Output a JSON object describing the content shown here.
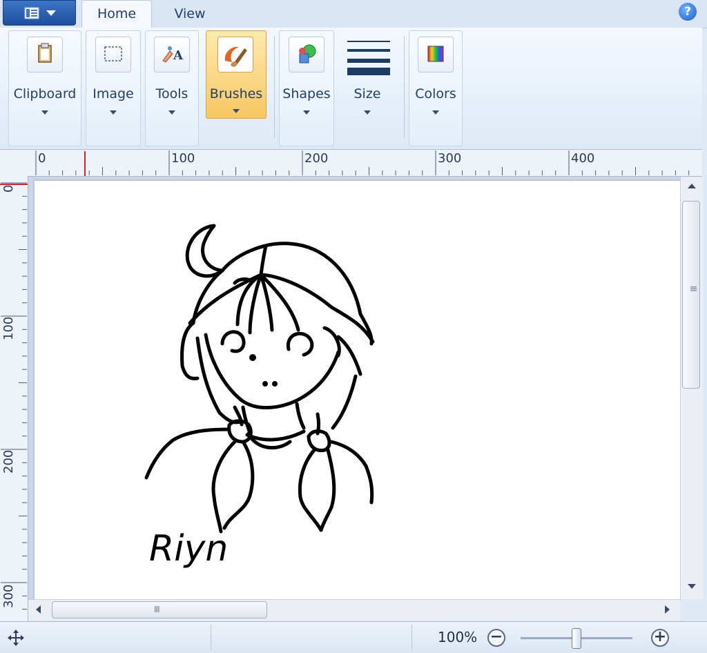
{
  "tabs": {
    "home": "Home",
    "view": "View"
  },
  "help_glyph": "?",
  "ribbon": {
    "clipboard": "Clipboard",
    "image": "Image",
    "tools": "Tools",
    "brushes": "Brushes",
    "shapes": "Shapes",
    "size": "Size",
    "colors": "Colors"
  },
  "ruler_h": [
    "0",
    "100",
    "200",
    "300",
    "400"
  ],
  "ruler_v": [
    "0",
    "100",
    "200",
    "300"
  ],
  "drawing": {
    "signature": "Riyn"
  },
  "status": {
    "zoom": "100%",
    "zoom_out": "−",
    "zoom_in": "+"
  },
  "scroll_grip": "III",
  "colors": {
    "accent": "#f7c760",
    "ribbon": "#e4eef9",
    "canvas": "#ffffff"
  }
}
